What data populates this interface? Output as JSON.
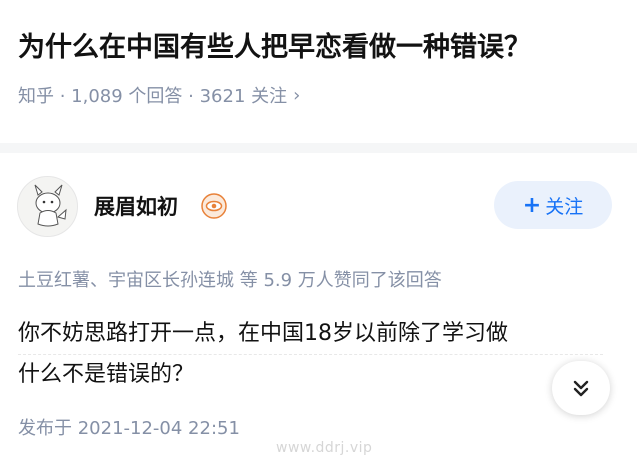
{
  "question": {
    "title": "为什么在中国有些人把早恋看做一种错误？",
    "meta": "知乎 · 1,089 个回答 · 3621 关注"
  },
  "author": {
    "name": "展眉如初",
    "follow_label": "关注"
  },
  "answer": {
    "likers": "土豆红薯、宇宙区长孙连城 等 5.9 万人赞同了该回答",
    "line1": "你不妨思路打开一点，在中国18岁以前除了学习做",
    "line2": "什么不是错误的？",
    "published": "发布于 2021-12-04 22:51"
  },
  "watermark": "www.ddrj.vip",
  "icons": {
    "meta_chevron": "chevron-right-icon",
    "badge": "eye-badge-icon",
    "expand": "double-chevron-down-icon"
  },
  "colors": {
    "accent": "#1772f6",
    "follow_bg": "#eaf1fc",
    "muted": "#8590a6",
    "badge_orange": "#e8823a"
  }
}
